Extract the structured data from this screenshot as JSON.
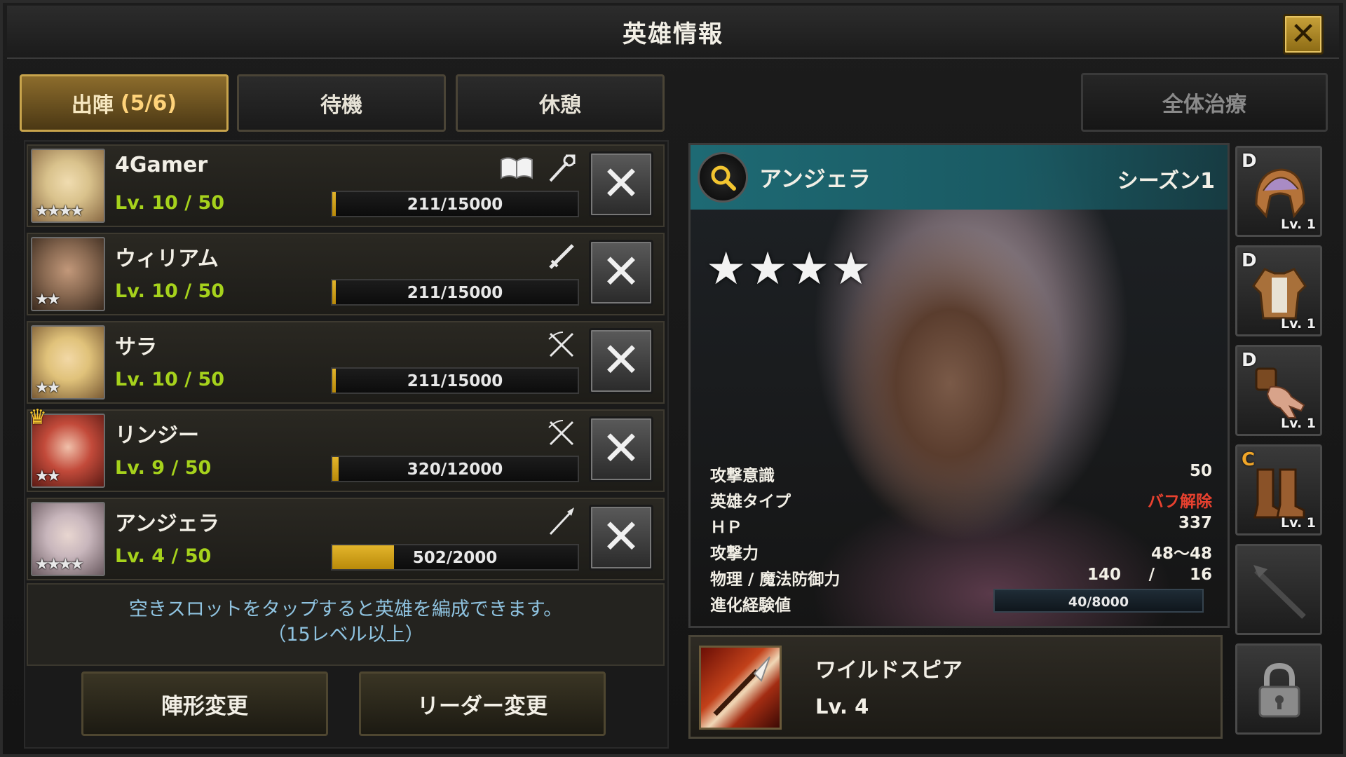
{
  "window": {
    "title": "英雄情報",
    "close_glyph": "✕"
  },
  "tabs": [
    {
      "label": "出陣",
      "count": "(5/6)",
      "active": true
    },
    {
      "label": "待機",
      "count": "",
      "active": false
    },
    {
      "label": "休憩",
      "count": "",
      "active": false
    }
  ],
  "heal_all_label": "全体治療",
  "heroes": [
    {
      "name": "4Gamer",
      "level": "Lv. 10 / 50",
      "exp": "211/15000",
      "exp_fraction": 0.014,
      "stars": "★★★★",
      "leader": false,
      "class_icons": [
        "book-icon",
        "staff-icon"
      ],
      "portrait_colors": [
        "#d9c28c",
        "#8a6a44"
      ]
    },
    {
      "name": "ウィリアム",
      "level": "Lv. 10 / 50",
      "exp": "211/15000",
      "exp_fraction": 0.014,
      "stars": "★★",
      "leader": false,
      "class_icons": [
        "sword-icon"
      ],
      "portrait_colors": [
        "#8a6a52",
        "#3a2a1e"
      ]
    },
    {
      "name": "サラ",
      "level": "Lv. 10 / 50",
      "exp": "211/15000",
      "exp_fraction": 0.014,
      "stars": "★★",
      "leader": false,
      "class_icons": [
        "crossed-bow-icon"
      ],
      "portrait_colors": [
        "#e0c27a",
        "#7a5a34"
      ]
    },
    {
      "name": "リンジー",
      "level": "Lv. 9 / 50",
      "exp": "320/12000",
      "exp_fraction": 0.027,
      "stars": "★★",
      "leader": true,
      "class_icons": [
        "crossed-bow-icon"
      ],
      "portrait_colors": [
        "#c24a3a",
        "#5a1a14"
      ]
    },
    {
      "name": "アンジェラ",
      "level": "Lv. 4 / 50",
      "exp": "502/2000",
      "exp_fraction": 0.251,
      "stars": "★★★★",
      "leader": false,
      "class_icons": [
        "spear-icon"
      ],
      "portrait_colors": [
        "#c8b6bc",
        "#6a5a60"
      ]
    }
  ],
  "remove_glyph": "✕",
  "hint_line1": "空きスロットをタップすると英雄を編成できます。",
  "hint_line2": "（15レベル以上）",
  "bottom_buttons": {
    "formation": "陣形変更",
    "leader": "リーダー変更"
  },
  "detail": {
    "name": "アンジェラ",
    "season": "シーズン1",
    "stars": "★★★★",
    "stats": {
      "attack_awareness_label": "攻撃意識",
      "attack_awareness_value": "50",
      "hero_type_label": "英雄タイプ",
      "hero_type_value": "バフ解除",
      "hp_label": "ＨＰ",
      "hp_value": "337",
      "attack_label": "攻撃力",
      "attack_value": "48～48",
      "defense_label": "物理 / 魔法防御力",
      "physical_defense": "140",
      "defense_sep": "/",
      "magic_defense": "16",
      "evolution_label": "進化経験値",
      "evolution_value": "40/8000"
    }
  },
  "skill": {
    "name": "ワイルドスピア",
    "level": "Lv. 4"
  },
  "equipment": [
    {
      "grade": "D",
      "level": "Lv. 1",
      "item": "helmet-icon"
    },
    {
      "grade": "D",
      "level": "Lv. 1",
      "item": "armor-icon"
    },
    {
      "grade": "D",
      "level": "Lv. 1",
      "item": "gloves-icon"
    },
    {
      "grade": "C",
      "level": "Lv. 1",
      "item": "boots-icon"
    },
    {
      "grade": "",
      "level": "",
      "item": "weapon-icon"
    },
    {
      "grade": "",
      "level": "",
      "item": "lock-icon"
    }
  ],
  "colors": {
    "accent_gold": "#c8a44c",
    "level_green": "#a6d21c",
    "hint_blue": "#8fc3e0",
    "buff_red": "#e8412f",
    "header_teal": "#1e6a74"
  }
}
